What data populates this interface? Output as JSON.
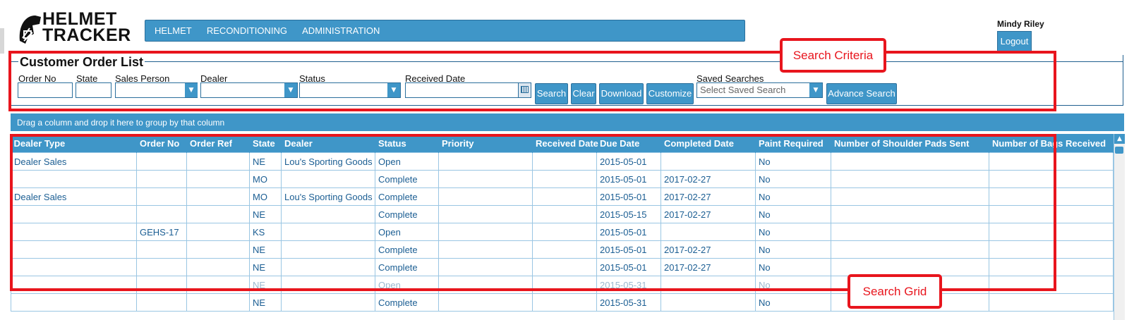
{
  "logo": {
    "line1": "HELMET",
    "line2": "TRACKER"
  },
  "nav": {
    "items": [
      "HELMET",
      "RECONDITIONING",
      "ADMINISTRATION"
    ]
  },
  "user": {
    "name": "Mindy Riley",
    "logout_label": "Logout"
  },
  "criteria": {
    "title": "Customer Order List",
    "labels": {
      "order_no": "Order No",
      "state": "State",
      "sales_person": "Sales Person",
      "dealer": "Dealer",
      "status": "Status",
      "received_date": "Received Date",
      "saved_searches": "Saved Searches"
    },
    "saved_search_placeholder": "Select Saved Search",
    "buttons": {
      "search": "Search",
      "clear": "Clear",
      "download": "Download",
      "customize": "Customize",
      "advance_search": "Advance Search"
    }
  },
  "grid": {
    "group_hint": "Drag a column and drop it here to group by that column",
    "columns": [
      "Dealer Type",
      "Order No",
      "Order Ref",
      "State",
      "Dealer",
      "Status",
      "Priority",
      "Received Date",
      "Due Date",
      "Completed Date",
      "Paint Required",
      "Number of Shoulder Pads Sent",
      "Number of Bags Received"
    ],
    "rows": [
      [
        "Dealer Sales",
        "",
        "",
        "NE",
        "Lou's Sporting Goods",
        "Open",
        "",
        "",
        "2015-05-01",
        "",
        "No",
        "",
        ""
      ],
      [
        "",
        "",
        "",
        "MO",
        "",
        "Complete",
        "",
        "",
        "2015-05-01",
        "2017-02-27",
        "No",
        "",
        ""
      ],
      [
        "Dealer Sales",
        "",
        "",
        "MO",
        "Lou's Sporting Goods",
        "Complete",
        "",
        "",
        "2015-05-01",
        "2017-02-27",
        "No",
        "",
        ""
      ],
      [
        "",
        "",
        "",
        "NE",
        "",
        "Complete",
        "",
        "",
        "2015-05-15",
        "2017-02-27",
        "No",
        "",
        ""
      ],
      [
        "",
        "GEHS-17",
        "",
        "KS",
        "",
        "Open",
        "",
        "",
        "2015-05-01",
        "",
        "No",
        "",
        ""
      ],
      [
        "",
        "",
        "",
        "NE",
        "",
        "Complete",
        "",
        "",
        "2015-05-01",
        "2017-02-27",
        "No",
        "",
        ""
      ],
      [
        "",
        "",
        "",
        "NE",
        "",
        "Complete",
        "",
        "",
        "2015-05-01",
        "2017-02-27",
        "No",
        "",
        ""
      ],
      [
        "",
        "",
        "",
        "NE",
        "",
        "Open",
        "",
        "",
        "2015-05-31",
        "",
        "No",
        "",
        ""
      ],
      [
        "",
        "",
        "",
        "NE",
        "",
        "Complete",
        "",
        "",
        "2015-05-31",
        "",
        "No",
        "",
        ""
      ]
    ]
  },
  "annotations": {
    "search_criteria": "Search Criteria",
    "search_grid": "Search Grid"
  },
  "colors": {
    "accent": "#3f96c8",
    "annotation": "#e8151d",
    "link_text": "#1b5e93"
  }
}
